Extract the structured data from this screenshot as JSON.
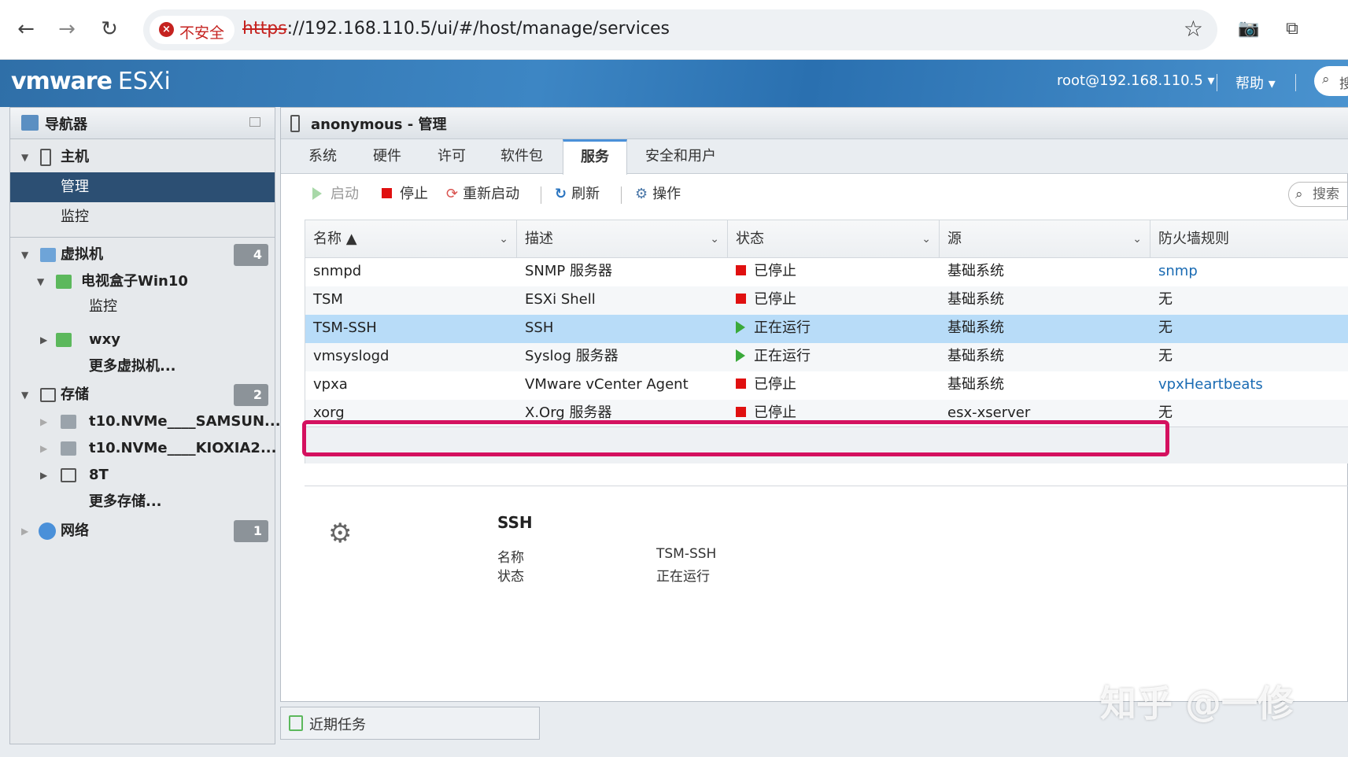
{
  "browser": {
    "insecure_label": "不安全",
    "url_scheme": "https",
    "url_rest": "://192.168.110.5/ui/#/host/manage/services"
  },
  "header": {
    "logo_vm": "vmware",
    "logo_esxi": "ESXi",
    "user": "root@192.168.110.5 ▾",
    "help": "帮助 ▾",
    "search_placeholder": "搜"
  },
  "navigator": {
    "title": "导航器",
    "host": "主机",
    "host_manage": "管理",
    "host_monitor": "监控",
    "vms": "虚拟机",
    "vms_count": "4",
    "vm1": "电视盒子Win10",
    "vm1_monitor": "监控",
    "vm2": "wxy",
    "more_vms": "更多虚拟机...",
    "storage": "存储",
    "storage_count": "2",
    "ds1": "t10.NVMe____SAMSUN...",
    "ds2": "t10.NVMe____KIOXIA2...",
    "ds3": "8T",
    "more_storage": "更多存储...",
    "network": "网络",
    "network_count": "1"
  },
  "main": {
    "title": "anonymous - 管理",
    "tabs": [
      "系统",
      "硬件",
      "许可",
      "软件包",
      "服务",
      "安全和用户"
    ],
    "toolbar": {
      "start": "启动",
      "stop": "停止",
      "restart": "重新启动",
      "refresh": "刷新",
      "actions": "操作",
      "search": "搜索"
    },
    "columns": [
      "名称 ▲",
      "描述",
      "状态",
      "源",
      "防火墙规则"
    ],
    "rows": [
      {
        "name": "snmpd",
        "desc": "SNMP 服务器",
        "status": "已停止",
        "running": false,
        "source": "基础系统",
        "firewall": "snmp"
      },
      {
        "name": "TSM",
        "desc": "ESXi Shell",
        "status": "已停止",
        "running": false,
        "source": "基础系统",
        "firewall": "无"
      },
      {
        "name": "TSM-SSH",
        "desc": "SSH",
        "status": "正在运行",
        "running": true,
        "source": "基础系统",
        "firewall": "无"
      },
      {
        "name": "vmsyslogd",
        "desc": "Syslog 服务器",
        "status": "正在运行",
        "running": true,
        "source": "基础系统",
        "firewall": "无"
      },
      {
        "name": "vpxa",
        "desc": "VMware vCenter Agent",
        "status": "已停止",
        "running": false,
        "source": "基础系统",
        "firewall": "vpxHeartbeats"
      },
      {
        "name": "xorg",
        "desc": "X.Org 服务器",
        "status": "已停止",
        "running": false,
        "source": "esx-xserver",
        "firewall": "无"
      }
    ],
    "details": {
      "title": "SSH",
      "name_label": "名称",
      "name_value": "TSM-SSH",
      "status_label": "状态",
      "status_value": "正在运行"
    }
  },
  "tasks": {
    "label": "近期任务"
  },
  "watermark": "知乎 @一修",
  "colors": {
    "accent": "#2c4f73",
    "selected_row": "#b8dcf8",
    "highlight": "#d4115f",
    "running": "#3aa93a",
    "stopped": "#e01010"
  }
}
